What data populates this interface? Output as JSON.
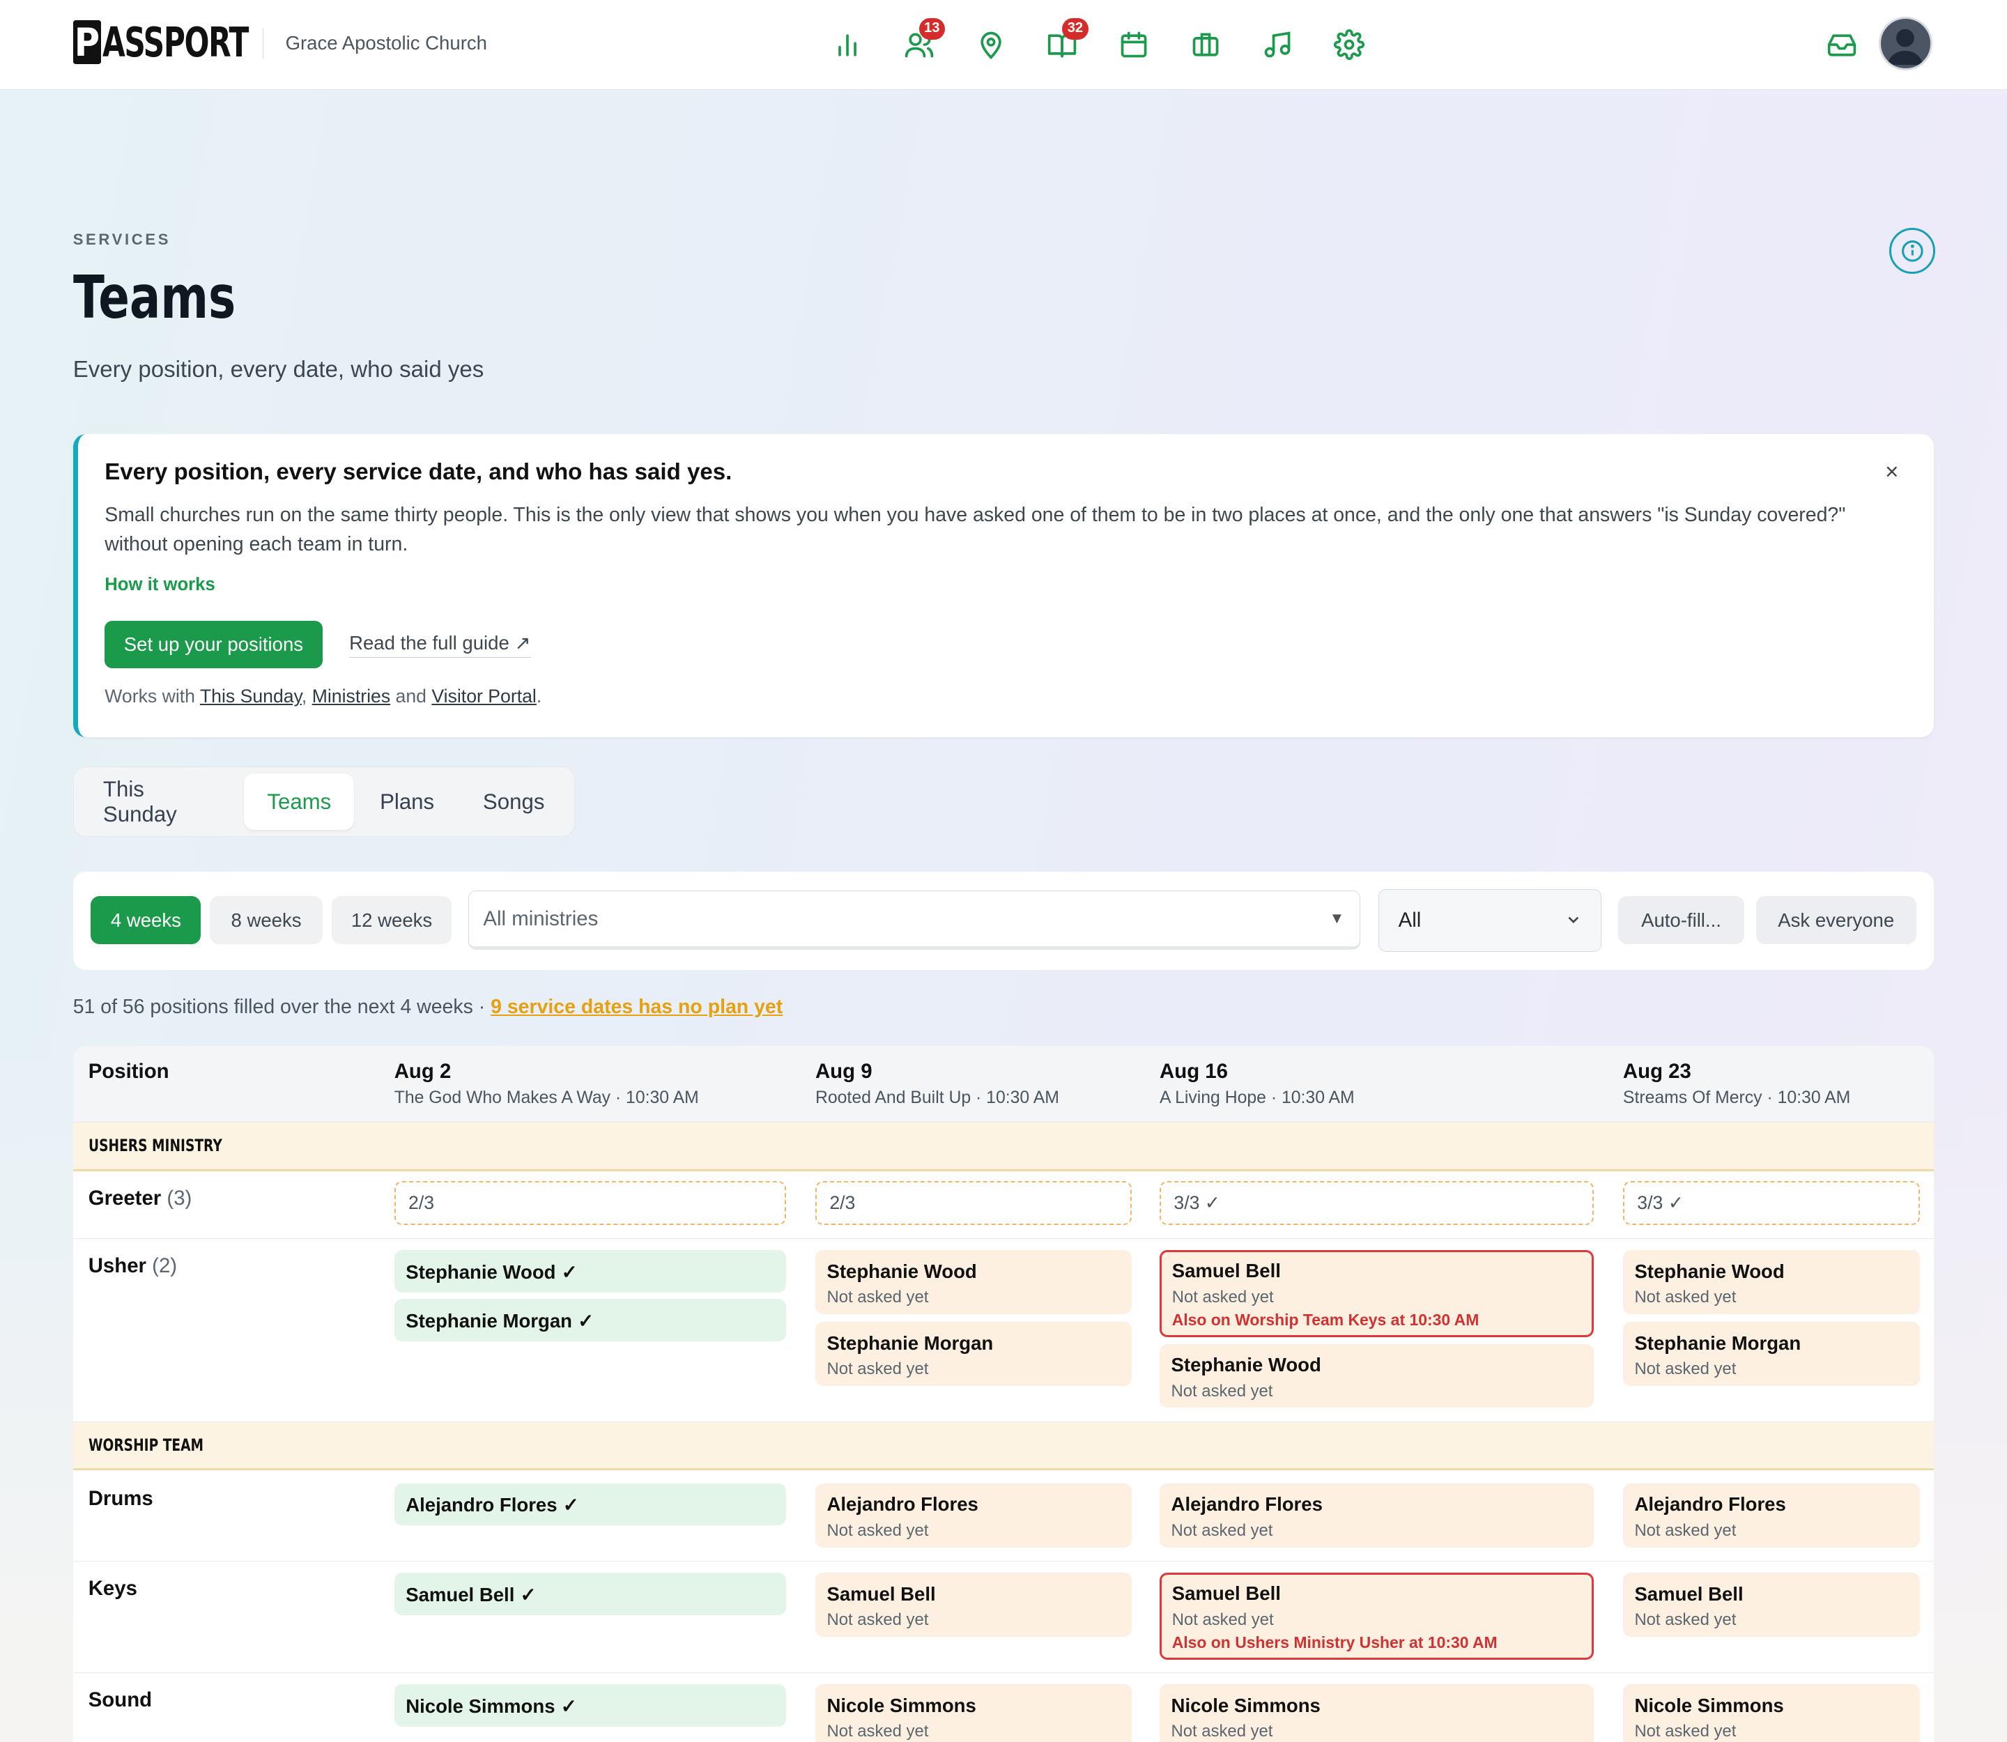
{
  "brand": {
    "logo_letter": "P",
    "logo_rest": "ASSPORT",
    "church": "Grace Apostolic Church"
  },
  "nav": {
    "badges": {
      "people": "13",
      "book": "32"
    }
  },
  "page": {
    "eyebrow": "SERVICES",
    "title": "Teams",
    "subtitle": "Every position, every date, who said yes"
  },
  "callout": {
    "heading": "Every position, every service date, and who has said yes.",
    "body": "Small churches run on the same thirty people. This is the only view that shows you when you have asked one of them to be in two places at once, and the only one that answers \"is Sunday covered?\" without opening each team in turn.",
    "how": "How it works",
    "cta": "Set up your positions",
    "guide": "Read the full guide ↗",
    "works_prefix": "Works with",
    "link1": "This Sunday",
    "link2": "Ministries",
    "and": "and",
    "link3": "Visitor Portal",
    "close": "×"
  },
  "tabs": [
    "This Sunday",
    "Teams",
    "Plans",
    "Songs"
  ],
  "toolbar": {
    "weeks": [
      "4 weeks",
      "8 weeks",
      "12 weeks"
    ],
    "ministries_placeholder": "All ministries",
    "status_value": "All",
    "autofill": "Auto-fill...",
    "ask": "Ask everyone"
  },
  "summary": {
    "text": "51 of 56 positions filled over the next 4 weeks · ",
    "warn": "9 service dates has no plan yet"
  },
  "table": {
    "position_header": "Position",
    "dates": [
      {
        "date": "Aug 2",
        "sub": "The God Who Makes A Way · 10:30 AM"
      },
      {
        "date": "Aug 9",
        "sub": "Rooted And Built Up · 10:30 AM"
      },
      {
        "date": "Aug 16",
        "sub": "A Living Hope · 10:30 AM"
      },
      {
        "date": "Aug 23",
        "sub": "Streams Of Mercy · 10:30 AM"
      }
    ],
    "sections": [
      "USHERS MINISTRY",
      "WORSHIP TEAM"
    ],
    "greeter": {
      "label": "Greeter",
      "count": "(3)",
      "caps": [
        "2/3",
        "2/3",
        "3/3 ✓",
        "3/3 ✓"
      ]
    },
    "usher": {
      "label": "Usher",
      "count": "(2)"
    },
    "drums": {
      "label": "Drums"
    },
    "keys": {
      "label": "Keys"
    },
    "sound": {
      "label": "Sound"
    },
    "names": {
      "sw": "Stephanie Wood",
      "sm": "Stephanie Morgan",
      "sb": "Samuel Bell",
      "af": "Alejandro Flores",
      "ns": "Nicole Simmons"
    },
    "confirmed": "✓",
    "not_asked": "Not asked yet",
    "conflict_usher": "Also on Worship Team Keys at 10:30 AM",
    "conflict_keys": "Also on Ushers Ministry Usher at 10:30 AM"
  }
}
